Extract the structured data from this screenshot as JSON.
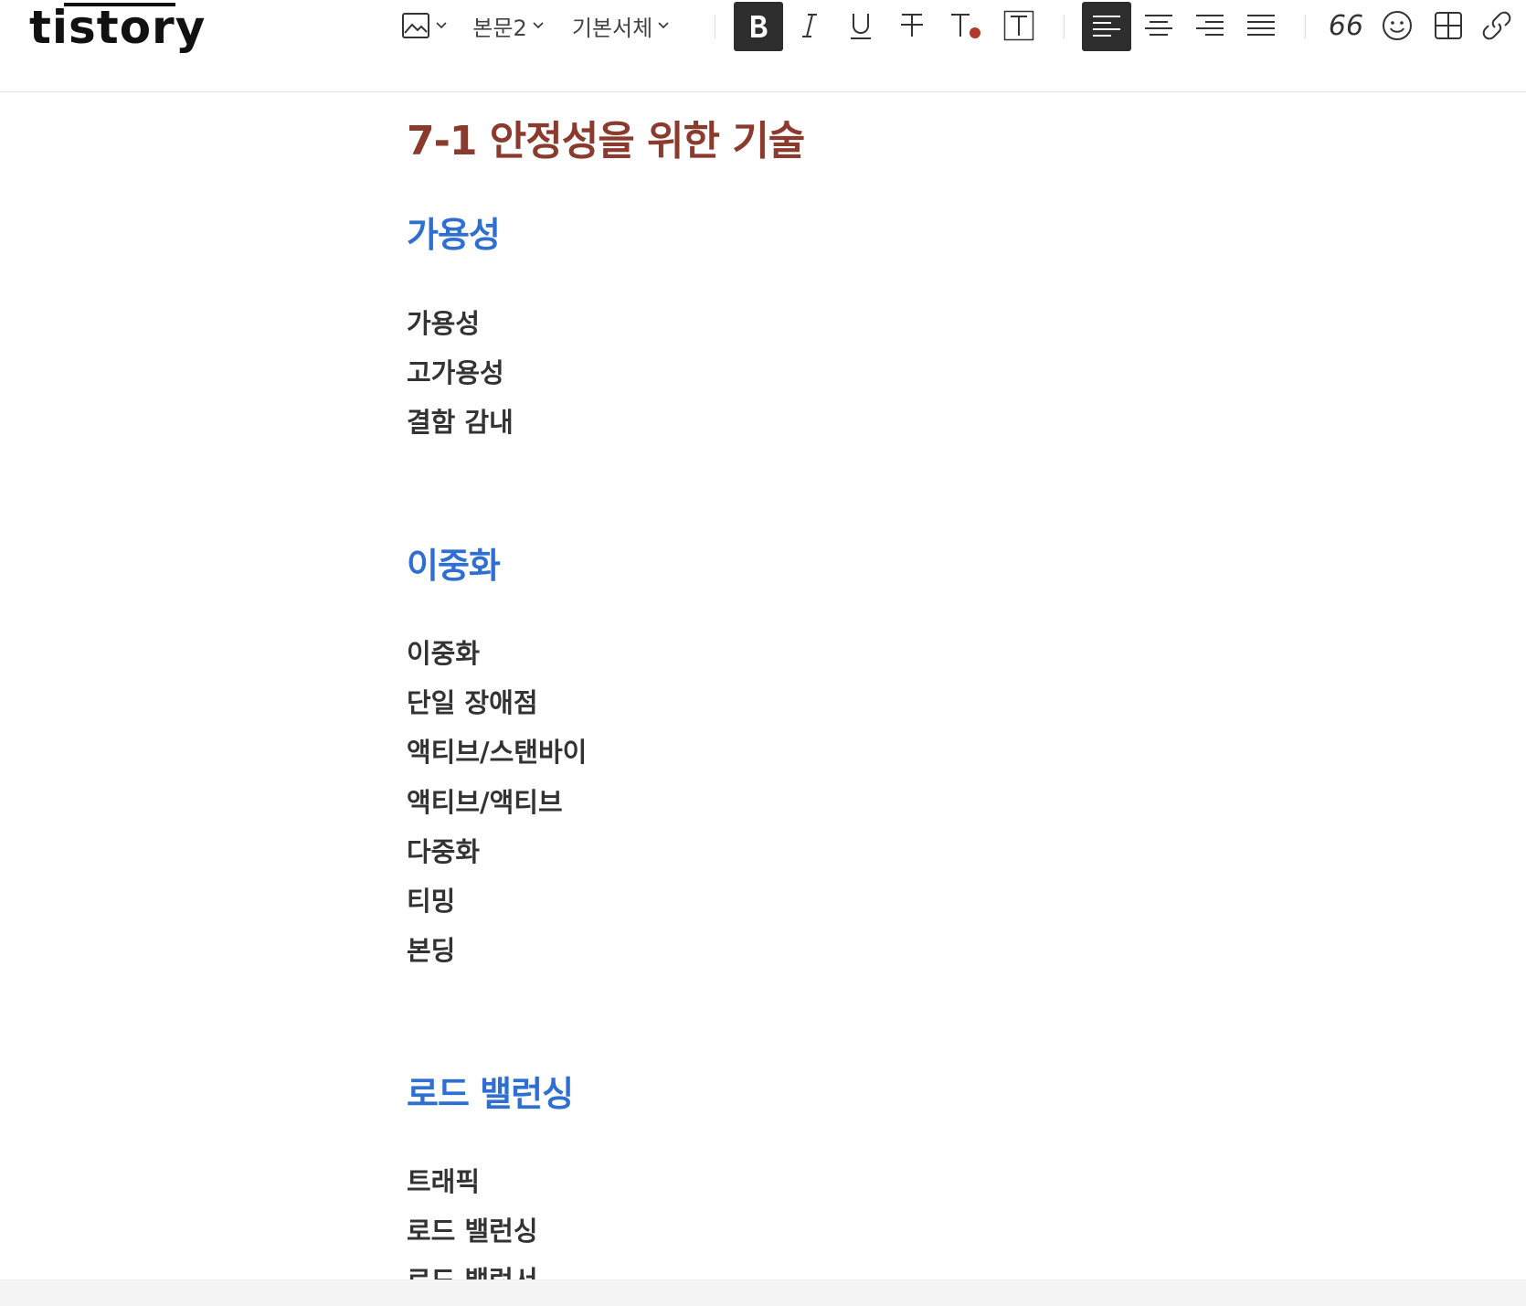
{
  "app": {
    "logo": "tistory"
  },
  "toolbar": {
    "paragraph_style": "본문2",
    "font": "기본서체",
    "quote_label": "66"
  },
  "colors": {
    "title": "#8b3a2e",
    "heading": "#2f6fd1",
    "text_color_dot": "#b0392b",
    "active_button_bg": "#2d2d2d"
  },
  "icons": [
    "image-icon",
    "chevron-down-icon",
    "bold-icon",
    "italic-icon",
    "underline-icon",
    "strikethrough-icon",
    "text-color-icon",
    "text-background-icon",
    "align-left-icon",
    "align-center-icon",
    "align-right-icon",
    "align-justify-icon",
    "quote-icon",
    "emoticon-icon",
    "table-icon",
    "link-icon"
  ],
  "document": {
    "title": "7-1 안정성을 위한 기술",
    "sections": [
      {
        "heading": "가용성",
        "items": [
          "가용성",
          "고가용성",
          "결함 감내"
        ]
      },
      {
        "heading": "이중화",
        "items": [
          "이중화",
          "단일 장애점",
          "액티브/스탠바이",
          "액티브/액티브",
          "다중화",
          "티밍",
          "본딩"
        ]
      },
      {
        "heading": "로드 밸런싱",
        "items": [
          "트래픽",
          "로드 밸런싱",
          "로드 밸런서"
        ]
      }
    ]
  }
}
